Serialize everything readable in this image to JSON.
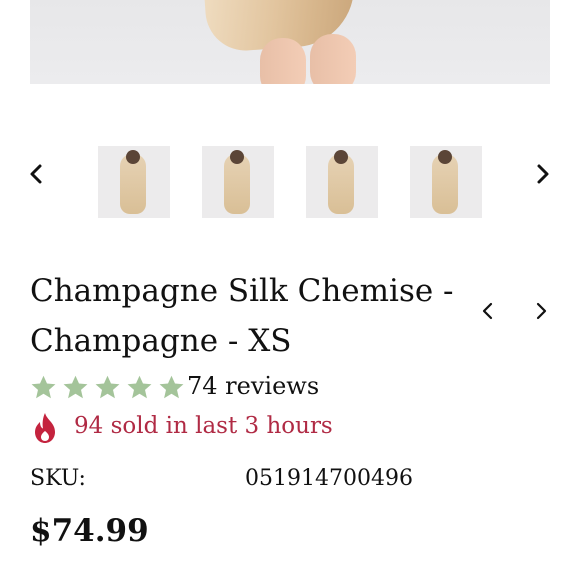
{
  "product": {
    "title_line1": "Champagne Silk Chemise -",
    "title_line2": "Champagne - XS",
    "reviews_text": "74 reviews",
    "rating": 5,
    "sold_text": "94 sold in last 3 hours",
    "sku_label": "SKU:",
    "sku_value": "051914700496",
    "price": "$74.99"
  },
  "gallery": {
    "thumbnails": [
      "thumbnail-1",
      "thumbnail-2",
      "thumbnail-3",
      "thumbnail-4"
    ]
  },
  "colors": {
    "star": "#a4c49a",
    "sold_text": "#b02a44",
    "fire": "#c4233e"
  },
  "icons": {
    "prev": "chevron-left-icon",
    "next": "chevron-right-icon",
    "star": "star-icon",
    "fire": "fire-icon"
  }
}
